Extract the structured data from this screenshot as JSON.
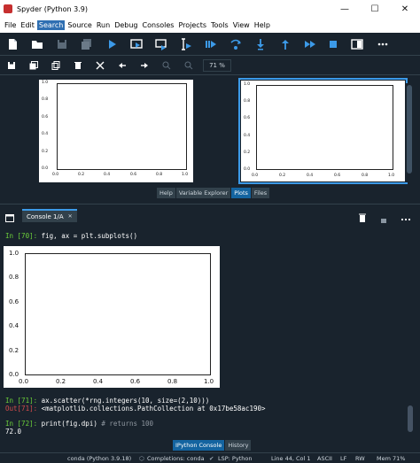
{
  "window": {
    "title": "Spyder (Python 3.9)",
    "minimize_glyph": "—",
    "maximize_glyph": "☐",
    "close_glyph": "✕"
  },
  "menu": {
    "items": [
      "File",
      "Edit",
      "Search",
      "Source",
      "Run",
      "Debug",
      "Consoles",
      "Projects",
      "Tools",
      "View",
      "Help"
    ]
  },
  "toolbar": {
    "icons": [
      "new-file-icon",
      "open-folder-icon",
      "save-icon",
      "save-all-icon",
      "run-icon",
      "run-cell-icon",
      "run-cell-advance-icon",
      "run-selection-icon",
      "debug-icon",
      "step-icon",
      "step-into-icon",
      "step-return-icon",
      "continue-icon",
      "stop-icon",
      "maximize-pane-icon",
      "more-icon"
    ]
  },
  "plots_toolbar": {
    "zoom_value": "71 %",
    "icons": [
      "save-plot-icon",
      "save-all-plots-icon",
      "copy-plot-icon",
      "remove-plot-icon",
      "remove-all-plots-icon",
      "previous-plot-icon",
      "next-plot-icon",
      "zoom-in-icon",
      "zoom-out-icon"
    ]
  },
  "plots": {
    "main_yticks": [
      "1.0",
      "0.8",
      "0.6",
      "0.4",
      "0.2",
      "0.0"
    ],
    "main_xticks": [
      "0.0",
      "0.2",
      "0.4",
      "0.6",
      "0.8",
      "1.0"
    ],
    "thumb_yticks": [
      "1.0",
      "0.8",
      "0.6",
      "0.4",
      "0.2",
      "0.0"
    ],
    "thumb_xticks": [
      "0.0",
      "0.2",
      "0.4",
      "0.6",
      "0.8",
      "1.0"
    ]
  },
  "dock_tabs": {
    "items": [
      "Help",
      "Variable Explorer",
      "Plots",
      "Files"
    ],
    "active": "Plots"
  },
  "console": {
    "tab_label": "Console 1/A",
    "tab_close": "✕",
    "line1_prompt": "In [70]:",
    "line1_code": " fig, ax = plt.subplots()",
    "figure_yticks": [
      "1.0",
      "0.8",
      "0.6",
      "0.4",
      "0.2",
      "0.0"
    ],
    "figure_xticks": [
      "0.0",
      "0.2",
      "0.4",
      "0.6",
      "0.8",
      "1.0"
    ],
    "line2_prompt": "In [71]:",
    "line2_code": " ax.scatter(*rng.integers(10, size=(2,10)))",
    "line3_prompt": "Out[71]:",
    "line3_value": " <matplotlib.collections.PathCollection at 0x17be58ac190>",
    "line4_prompt": "In [72]:",
    "line4_code": " print(fig.dpi)",
    "line4_comment": " # returns 100",
    "line5_output": "72.0"
  },
  "bottom_tabs": {
    "items": [
      "IPython Console",
      "History"
    ],
    "active": "IPython Console"
  },
  "status": {
    "env": "conda (Python 3.9.18)",
    "completions": "Completions: conda",
    "lsp": "LSP: Python",
    "position": "Line 44, Col 1",
    "encoding": "ASCII",
    "eol": "LF",
    "permissions": "RW",
    "memory": "Mem 71%"
  },
  "colors": {
    "background": "#19232d",
    "accent": "#3c9ae8",
    "prompt_in": "#6cd13a",
    "prompt_out": "#d54c4c",
    "toolbar_icon": "#3c9ae8"
  }
}
